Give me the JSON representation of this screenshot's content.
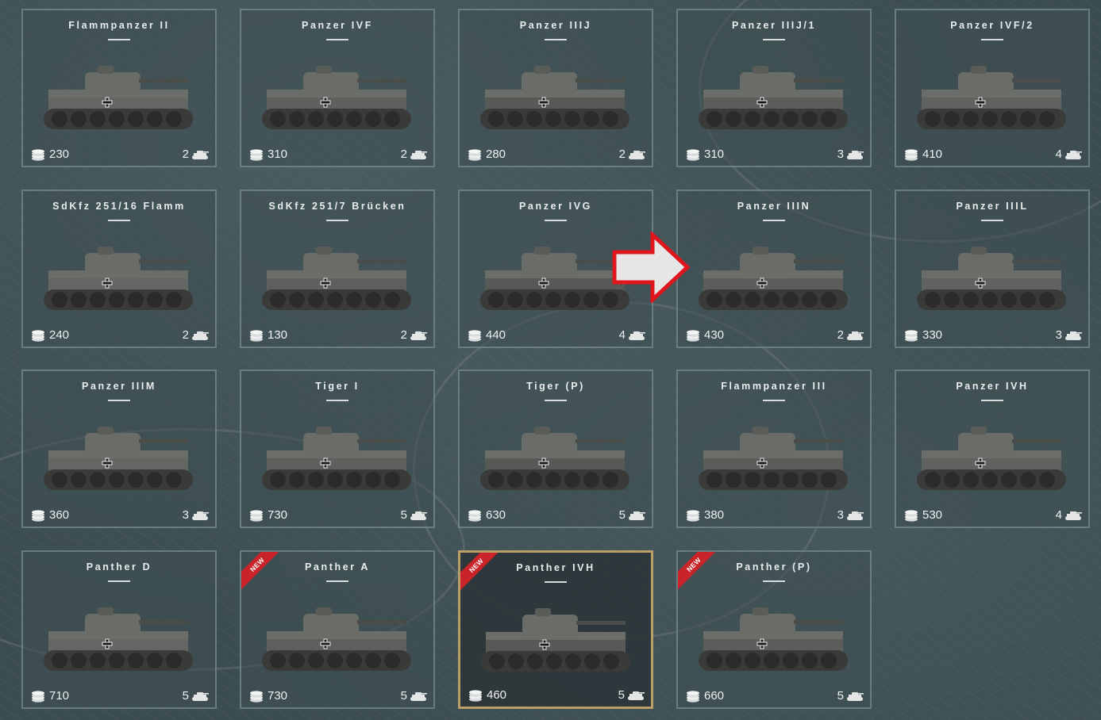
{
  "vehicles": [
    {
      "name": "Flammpanzer II",
      "cost": "230",
      "tier": "2",
      "new": false,
      "selected": false
    },
    {
      "name": "Panzer IVF",
      "cost": "310",
      "tier": "2",
      "new": false,
      "selected": false
    },
    {
      "name": "Panzer IIIJ",
      "cost": "280",
      "tier": "2",
      "new": false,
      "selected": false
    },
    {
      "name": "Panzer IIIJ/1",
      "cost": "310",
      "tier": "3",
      "new": false,
      "selected": false
    },
    {
      "name": "Panzer IVF/2",
      "cost": "410",
      "tier": "4",
      "new": false,
      "selected": false
    },
    {
      "name": "SdKfz 251/16 Flamm",
      "cost": "240",
      "tier": "2",
      "new": false,
      "selected": false
    },
    {
      "name": "SdKfz 251/7 Brücken",
      "cost": "130",
      "tier": "2",
      "new": false,
      "selected": false
    },
    {
      "name": "Panzer IVG",
      "cost": "440",
      "tier": "4",
      "new": false,
      "selected": false
    },
    {
      "name": "Panzer IIIN",
      "cost": "430",
      "tier": "2",
      "new": false,
      "selected": false
    },
    {
      "name": "Panzer IIIL",
      "cost": "330",
      "tier": "3",
      "new": false,
      "selected": false
    },
    {
      "name": "Panzer IIIM",
      "cost": "360",
      "tier": "3",
      "new": false,
      "selected": false
    },
    {
      "name": "Tiger I",
      "cost": "730",
      "tier": "5",
      "new": false,
      "selected": false
    },
    {
      "name": "Tiger (P)",
      "cost": "630",
      "tier": "5",
      "new": false,
      "selected": false
    },
    {
      "name": "Flammpanzer III",
      "cost": "380",
      "tier": "3",
      "new": false,
      "selected": false
    },
    {
      "name": "Panzer IVH",
      "cost": "530",
      "tier": "4",
      "new": false,
      "selected": false
    },
    {
      "name": "Panther D",
      "cost": "710",
      "tier": "5",
      "new": false,
      "selected": false
    },
    {
      "name": "Panther A",
      "cost": "730",
      "tier": "5",
      "new": true,
      "selected": false
    },
    {
      "name": "Panther IVH",
      "cost": "460",
      "tier": "5",
      "new": true,
      "selected": true
    },
    {
      "name": "Panther (P)",
      "cost": "660",
      "tier": "5",
      "new": true,
      "selected": false
    }
  ],
  "new_badge_label": "NEW",
  "icons": {
    "cost": "coin-stack-icon",
    "tier": "tank-tier-icon",
    "arrow": "arrow-right-icon"
  },
  "colors": {
    "selected_border": "#b99e68",
    "new_ribbon": "#c8242a",
    "arrow_outline": "#e0161e",
    "arrow_fill": "#e6e6e6"
  }
}
